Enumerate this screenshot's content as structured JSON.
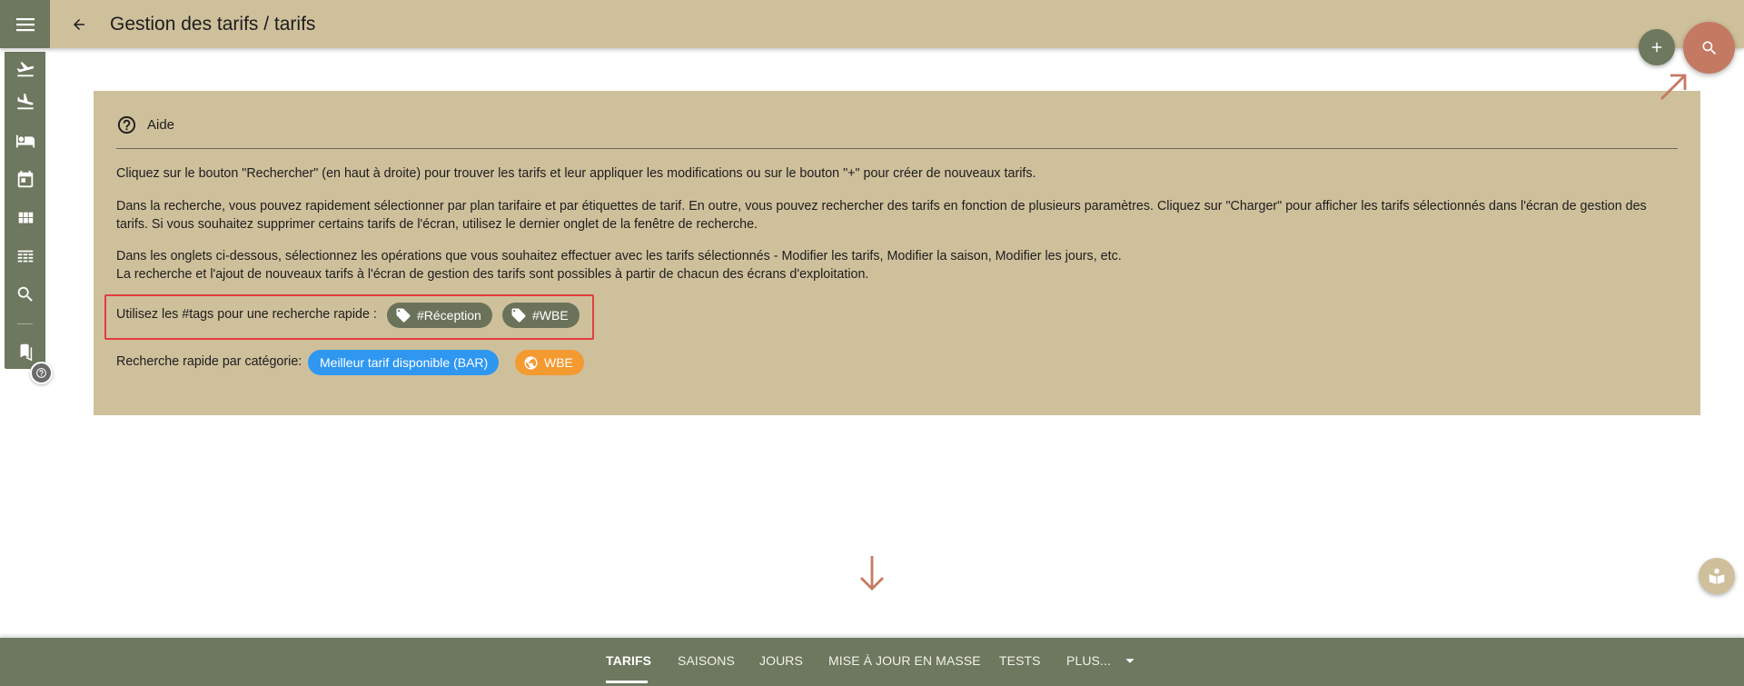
{
  "header": {
    "title": "Gestion des tarifs / tarifs"
  },
  "sidebar": {
    "items": [
      {
        "icon": "flight-takeoff-icon"
      },
      {
        "icon": "flight-land-icon"
      },
      {
        "icon": "hotel-bed-icon"
      },
      {
        "icon": "calendar-icon"
      },
      {
        "icon": "grid-icon"
      },
      {
        "icon": "table-icon"
      },
      {
        "icon": "search-icon"
      },
      {
        "icon": "bookmarks-icon"
      }
    ]
  },
  "help": {
    "title": "Aide",
    "paragraphs": [
      [
        "Cliquez sur le bouton \"Rechercher\" (en haut à droite) pour trouver les tarifs et leur appliquer les modifications ou sur le bouton \"+\" pour créer de nouveaux tarifs."
      ],
      [
        "Dans la recherche, vous pouvez rapidement sélectionner par plan tarifaire et par étiquettes de tarif. En outre, vous pouvez rechercher des tarifs en fonction de plusieurs paramètres. Cliquez sur \"Charger\" pour afficher les tarifs sélectionnés dans l'écran de gestion des",
        "tarifs. Si vous souhaitez supprimer certains tarifs de l'écran, utilisez le dernier onglet de la fenêtre de recherche."
      ],
      [
        "Dans les onglets ci-dessous, sélectionnez les opérations que vous souhaitez effectuer avec les tarifs sélectionnés - Modifier les tarifs, Modifier la saison, Modifier les jours, etc.",
        "La recherche et l'ajout de nouveaux tarifs à l'écran de gestion des tarifs sont possibles à partir de chacun des écrans d'exploitation."
      ]
    ],
    "tags_label": "Utilisez les #tags pour une recherche rapide :",
    "tags": [
      "#Réception",
      "#WBE"
    ],
    "category_label": "Recherche rapide par catégorie:",
    "categories": [
      {
        "label": "Meilleur tarif disponible (BAR)",
        "color": "#2f97f0"
      },
      {
        "label": "WBE",
        "color": "#f39a30",
        "icon": "globe-icon"
      }
    ]
  },
  "tabs": [
    {
      "label": "TARIFS",
      "active": true
    },
    {
      "label": "SAISONS",
      "active": false
    },
    {
      "label": "JOURS",
      "active": false
    },
    {
      "label": "MISE À JOUR EN MASSE",
      "active": false
    },
    {
      "label": "TESTS",
      "active": false
    },
    {
      "label": "PLUS...",
      "active": false
    }
  ],
  "colors": {
    "primary": "#6d785e",
    "header_bg": "#cfc09c",
    "accent": "#c47a62",
    "highlight": "#e23d3d"
  }
}
